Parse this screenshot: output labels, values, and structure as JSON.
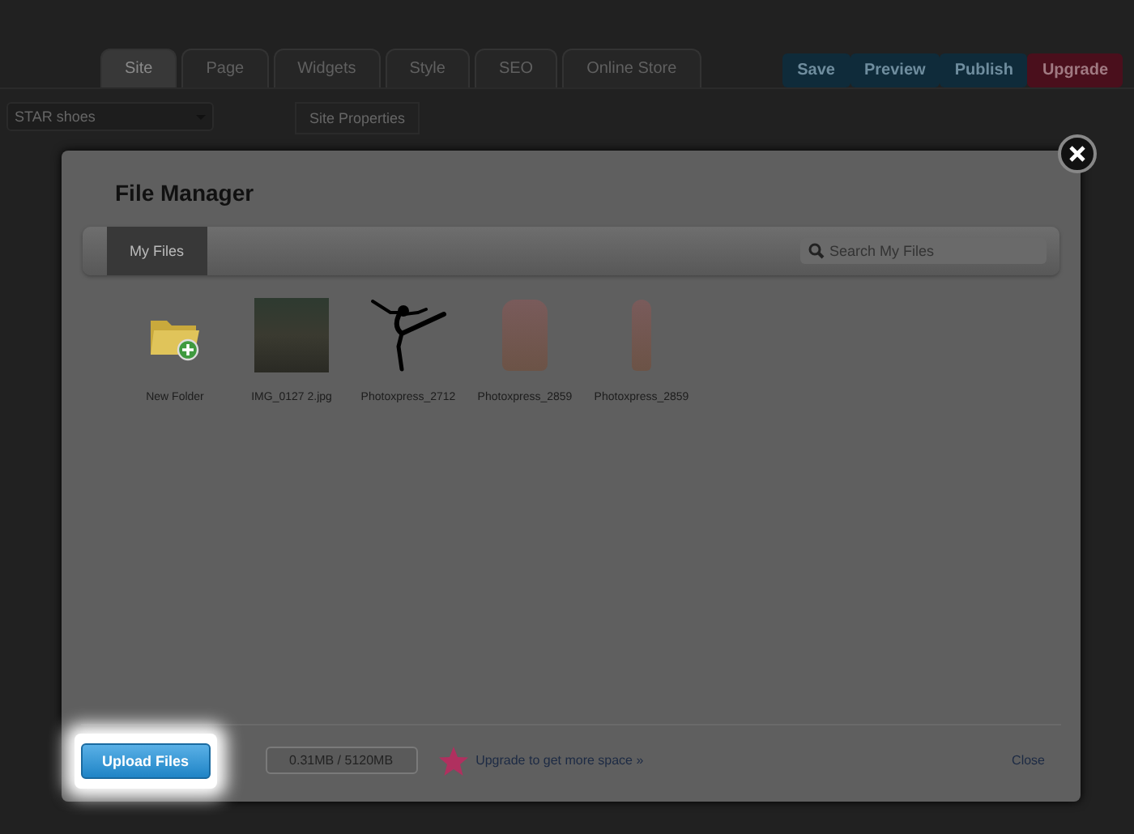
{
  "app": {
    "tabs": [
      {
        "label": "Site",
        "selected": true
      },
      {
        "label": "Page",
        "selected": false
      },
      {
        "label": "Widgets",
        "selected": false
      },
      {
        "label": "Style",
        "selected": false
      },
      {
        "label": "SEO",
        "selected": false
      },
      {
        "label": "Online Store",
        "selected": false
      }
    ],
    "buttons": [
      {
        "label": "Save",
        "kind": "blue"
      },
      {
        "label": "Preview",
        "kind": "blue"
      },
      {
        "label": "Publish",
        "kind": "blue"
      },
      {
        "label": "Upgrade",
        "kind": "red"
      }
    ],
    "site_select": "STAR shoes",
    "panel_item": "Site Properties"
  },
  "dialog": {
    "title": "File Manager",
    "tabs": [
      {
        "label": "My Files",
        "selected": true
      }
    ],
    "search": {
      "placeholder": "Search My Files"
    },
    "files": [
      {
        "kind": "folder",
        "name": "New Folder"
      },
      {
        "kind": "photo",
        "name": "IMG_0127 2.jpg"
      },
      {
        "kind": "silhouette",
        "name": "Photoxpress_2712"
      },
      {
        "kind": "shoe",
        "name": "Photoxpress_2859"
      },
      {
        "kind": "shoe-narrow",
        "name": "Photoxpress_2859"
      }
    ],
    "upload_button": "Upload Files",
    "storage": "0.31MB / 5120MB",
    "upgrade_link": "Upgrade to get more space »",
    "close_link": "Close"
  }
}
